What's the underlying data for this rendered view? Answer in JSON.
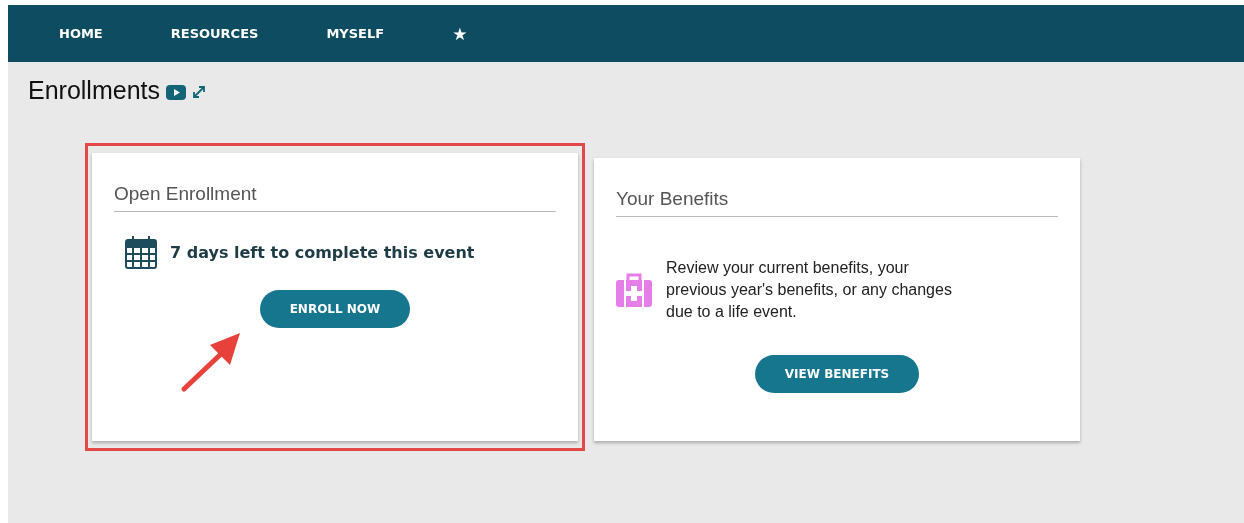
{
  "nav": {
    "items": [
      {
        "label": "HOME",
        "kind": "text"
      },
      {
        "label": "RESOURCES",
        "kind": "text"
      },
      {
        "label": "MYSELF",
        "kind": "text"
      },
      {
        "label": "★",
        "kind": "icon"
      }
    ]
  },
  "page": {
    "title": "Enrollments"
  },
  "cards": [
    {
      "title": "Open Enrollment",
      "kind": "event",
      "message": "7 days left to complete this event",
      "button": "ENROLL NOW",
      "highlighted": true
    },
    {
      "title": "Your Benefits",
      "kind": "benefits",
      "message": "Review your current benefits, your previous year's benefits, or any changes due to a life event.",
      "button": "VIEW BENEFITS",
      "highlighted": false
    }
  ]
}
